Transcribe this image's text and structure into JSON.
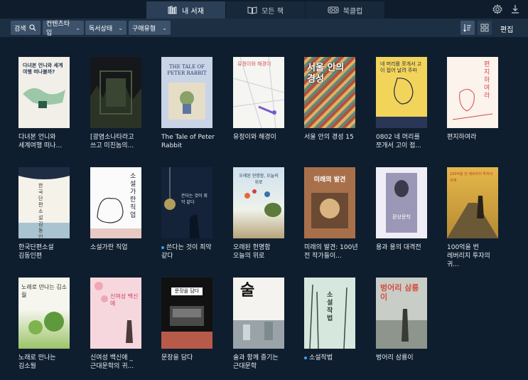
{
  "tabs": [
    {
      "label": "내 서재",
      "icon": "library-icon"
    },
    {
      "label": "모든 책",
      "icon": "open-book-icon"
    },
    {
      "label": "북클럽",
      "icon": "vr-glasses-icon"
    }
  ],
  "toolbar": {
    "search_label": "검색",
    "filters": [
      "컨텐츠타입",
      "독서상태",
      "구매유형"
    ],
    "edit_label": "편집"
  },
  "books": [
    {
      "title": "다녀본 언니와 세계여행 떠나...",
      "cover_text": "다녀본 언니와 세계여행 떠나볼까?",
      "dot": false
    },
    {
      "title": "[광염소나타라고 쓰고 미친놈의...",
      "cover_text": "",
      "dot": false
    },
    {
      "title": "The Tale of Peter Rabbit",
      "cover_text": "THE TALE OF PETER RABBIT",
      "dot": false
    },
    {
      "title": "유정이와 해경이",
      "cover_text": "유정이와 해경이",
      "dot": false
    },
    {
      "title": "서울 안의 경성 15",
      "cover_text": "서울 안의 경성",
      "dot": false
    },
    {
      "title": "0802 네 머리를 쪼개서 고이 접...",
      "cover_text": "네 머리를 쪼개서 고이 접어 날려 주마",
      "dot": false
    },
    {
      "title": "편지하여라",
      "cover_text": "편지하여라",
      "dot": false
    },
    {
      "title": "한국단편소설 김동인편",
      "cover_text": "한국단편소설 김동인편",
      "dot": false
    },
    {
      "title": "소설가란 직업",
      "cover_text": "소설가란 직업",
      "dot": false
    },
    {
      "title": "쓴다는 것이 죄악 같다",
      "cover_text": "쓴다는 것이 죄악 같다",
      "dot": true
    },
    {
      "title": "오래된 헌명함 오늘의 위로",
      "cover_text": "오래된 헌명함, 오늘의 위로",
      "dot": false
    },
    {
      "title": "미래의 발견: 100년 전 작가들이...",
      "cover_text": "미래의 발견",
      "dot": false
    },
    {
      "title": "용과 용의 대격전",
      "cover_text": "환상문학",
      "dot": false
    },
    {
      "title": "100억을 번 레버리지 투자의 귀...",
      "cover_text": "100억을 번 레버리지 투자의 귀재",
      "dot": false
    },
    {
      "title": "노래로 만나는 김소월",
      "cover_text": "노래로 만나는 김소월",
      "dot": false
    },
    {
      "title": "신여성 백신애 _ 근대문학의 귀...",
      "cover_text": "신여성 백신애",
      "dot": false
    },
    {
      "title": "문장을 담다",
      "cover_text": "문장을 담다",
      "dot": false
    },
    {
      "title": "술과 함께 즐기는 근대문학",
      "cover_text": "술",
      "dot": false
    },
    {
      "title": "소설작법",
      "cover_text": "소설작법",
      "dot": true
    },
    {
      "title": "벙어리 삼룡이",
      "cover_text": "벙어리 삼룡이",
      "dot": false
    }
  ]
}
